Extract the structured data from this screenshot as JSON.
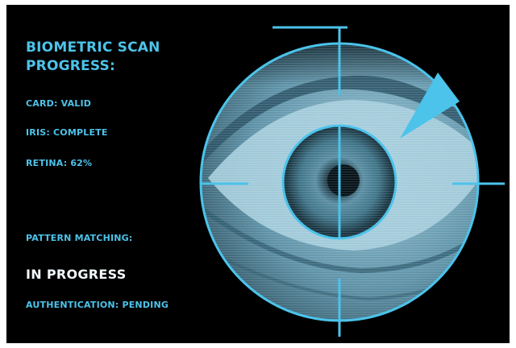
{
  "scan_panel": {
    "title": "BIOMETRIC SCAN PROGRESS:",
    "card_status": "CARD: VALID",
    "iris_status": "IRIS: COMPLETE",
    "retina_status": "RETINA: 62%",
    "retina_progress_percent": 62,
    "pattern_label": "PATTERN MATCHING:",
    "pattern_status": "IN PROGRESS",
    "auth_status": "AUTHENTICATION: PENDING"
  },
  "colors": {
    "background": "#000000",
    "accent": "#4cc3ea",
    "highlight_text": "#f2f7fa",
    "eye_tint": "#3a6f84"
  },
  "icons": {
    "reticle": "target-reticle-icon",
    "pointer": "triangle-pointer-icon"
  }
}
